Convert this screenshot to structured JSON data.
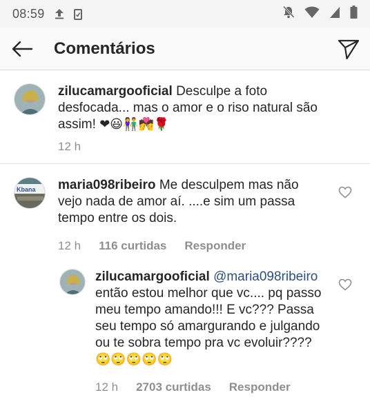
{
  "status_bar": {
    "time": "08:59"
  },
  "header": {
    "title": "Comentários"
  },
  "comments": [
    {
      "username": "zilucamargooficial",
      "text": "Desculpe a foto desfocada... mas o amor e o riso natural são assim!",
      "emojis": "❤😃👫💏🌹",
      "time": "12 h"
    },
    {
      "username": "maria098ribeiro",
      "text": "Me desculpem mas não vejo nada de amor aí. ....e sim um passa tempo entre os dois.",
      "time": "12 h",
      "likes": "116 curtidas",
      "reply_label": "Responder"
    },
    {
      "username": "zilucamargooficial",
      "mention": "@maria098ribeiro",
      "text": "então estou melhor que vc.... pq passo meu tempo amando!!! E vc??? Passa seu tempo só amargurando e julgando ou te sobra tempo pra vc evoluir????",
      "emojis": "🙄🙄🙄🙄🙄",
      "time": "12 h",
      "likes": "2703 curtidas",
      "reply_label": "Responder"
    }
  ]
}
